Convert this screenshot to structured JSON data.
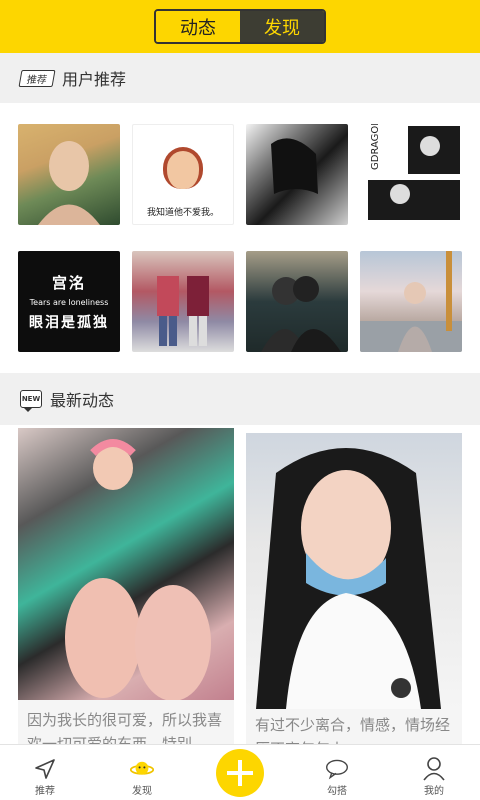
{
  "header": {
    "tabs": [
      {
        "label": "动态",
        "active": false
      },
      {
        "label": "发现",
        "active": true
      }
    ]
  },
  "recommend": {
    "badge": "推荐",
    "title": "用户推荐",
    "avatars": [
      {
        "id": "u1"
      },
      {
        "id": "u2",
        "caption": "我知道他不爱我。"
      },
      {
        "id": "u3"
      },
      {
        "id": "u4",
        "caption": "GDRAGON"
      },
      {
        "id": "u5",
        "line1": "宫洺",
        "line2": "Tears are loneliness",
        "line3": "眼泪是孤独"
      },
      {
        "id": "u6"
      },
      {
        "id": "u7"
      },
      {
        "id": "u8"
      }
    ]
  },
  "latest": {
    "badge": "NEW",
    "title": "最新动态",
    "posts": [
      {
        "text": "因为我长的很可爱，所以我喜欢一切可爱的东西，特别"
      },
      {
        "text": "有过不少离合，情感，情场经历不离年年上"
      }
    ]
  },
  "nav": {
    "items": [
      {
        "label": "推荐",
        "icon": "navigation-arrow-icon"
      },
      {
        "label": "发现",
        "icon": "planet-icon"
      },
      {
        "label": "",
        "icon": "plus-icon"
      },
      {
        "label": "勾搭",
        "icon": "chat-bubble-icon"
      },
      {
        "label": "我的",
        "icon": "person-icon"
      }
    ]
  },
  "colors": {
    "accent": "#fdd600",
    "dark": "#3d3d33"
  }
}
